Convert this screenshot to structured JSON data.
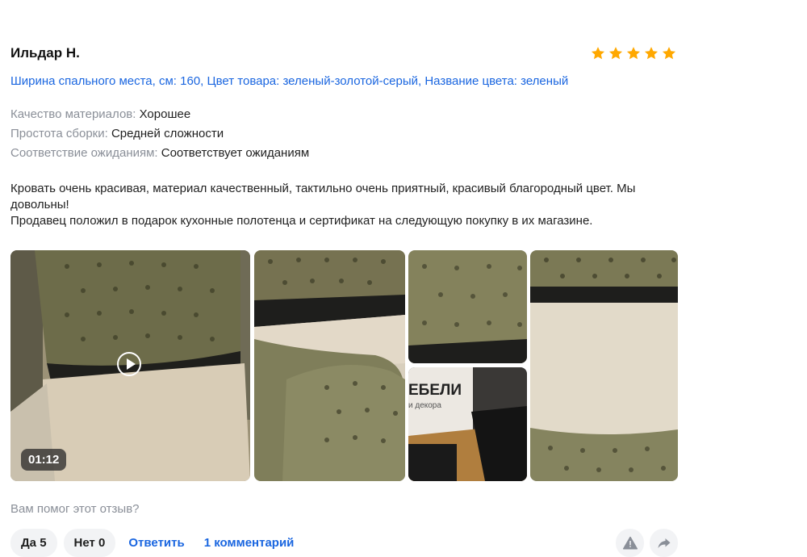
{
  "review": {
    "author": "Ильдар Н.",
    "rating": 5,
    "rating_max": 5,
    "star_color": "#ffa800",
    "variant": "Ширина спального места, см: 160, Цвет товара: зеленый-золотой-серый, Название цвета: зеленый",
    "attributes": [
      {
        "label": "Качество материалов:",
        "value": "Хорошее"
      },
      {
        "label": "Простота сборки:",
        "value": "Средней сложности"
      },
      {
        "label": "Соответствие ожиданиям:",
        "value": "Соответствует ожиданиям"
      }
    ],
    "text_lines": [
      "Кровать очень красивая, материал качественный, тактильно очень приятный, красивый благородный цвет. Мы довольны!",
      "Продавец положил в подарок кухонные полотенца и сертификат на следующую покупку в их магазине."
    ]
  },
  "media": {
    "video_duration": "01:12",
    "box_text_1": "ЕБЕЛИ",
    "box_text_2": "и декора"
  },
  "footer": {
    "helpful_question": "Вам помог этот отзыв?",
    "yes_label": "Да",
    "yes_count": "5",
    "no_label": "Нет",
    "no_count": "0",
    "reply_label": "Ответить",
    "comments_label": "1 комментарий"
  },
  "colors": {
    "link": "#1a66e0",
    "muted": "#8a8f98",
    "pill_bg": "#f2f3f5"
  }
}
